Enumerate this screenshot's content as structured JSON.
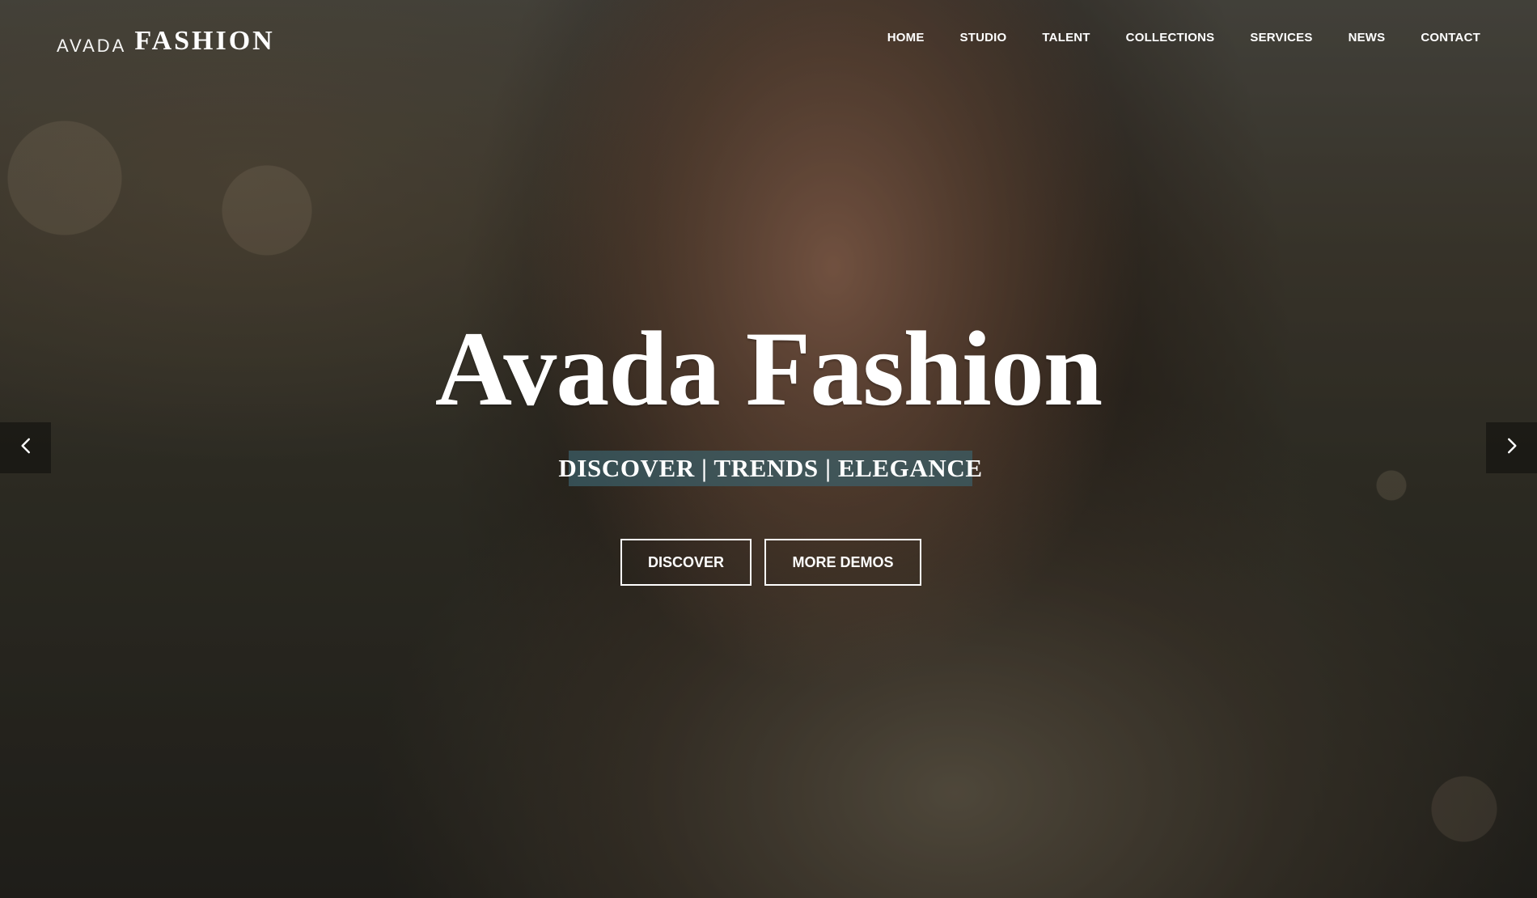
{
  "brand": {
    "logo_small": "AVADA",
    "logo_big": "FASHION"
  },
  "nav": {
    "items": [
      {
        "label": "HOME"
      },
      {
        "label": "STUDIO"
      },
      {
        "label": "TALENT"
      },
      {
        "label": "COLLECTIONS"
      },
      {
        "label": "SERVICES"
      },
      {
        "label": "NEWS"
      },
      {
        "label": "CONTACT"
      }
    ]
  },
  "hero": {
    "title": "Avada Fashion",
    "tagline": "DISCOVER | TRENDS | ELEGANCE",
    "buttons": {
      "primary": "DISCOVER",
      "secondary": "MORE DEMOS"
    }
  },
  "icons": {
    "prev": "chevron-left-icon",
    "next": "chevron-right-icon"
  },
  "colors": {
    "tagline_bg": "#3C5F69"
  }
}
